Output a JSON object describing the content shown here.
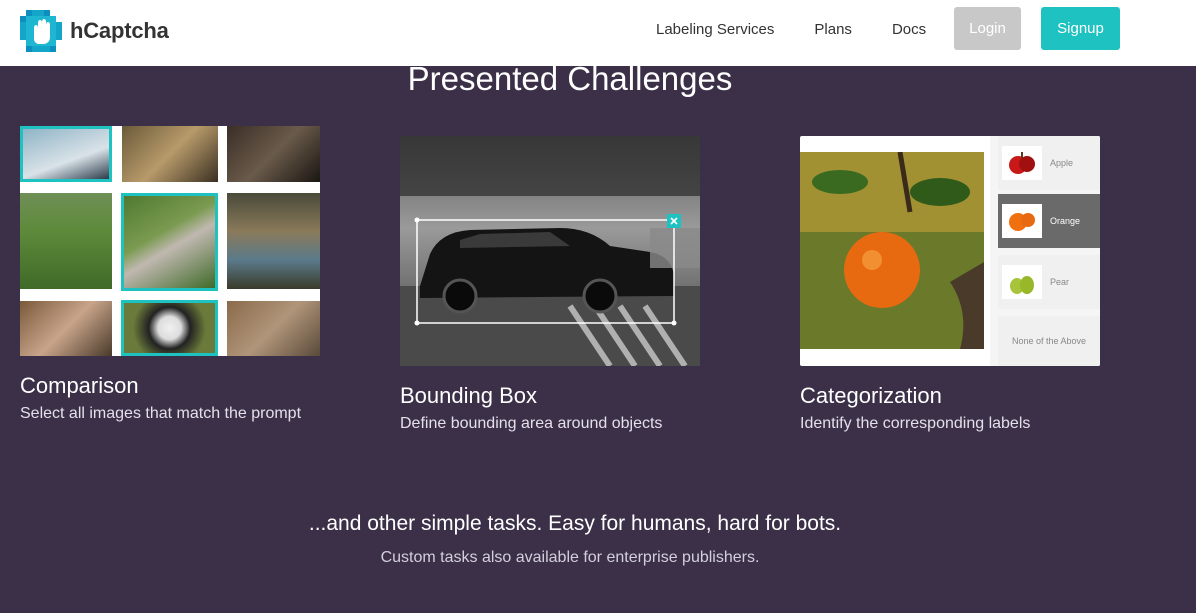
{
  "nav": {
    "brand": "hCaptcha",
    "links": [
      "Labeling Services",
      "Plans",
      "Docs"
    ],
    "login": "Login",
    "signup": "Signup"
  },
  "section": {
    "title": "Presented Challenges"
  },
  "cards": [
    {
      "title": "Comparison",
      "desc": "Select all images that match the prompt"
    },
    {
      "title": "Bounding Box",
      "desc": "Define bounding area around objects"
    },
    {
      "title": "Categorization",
      "desc": "Identify the corresponding labels"
    }
  ],
  "categorization": {
    "options": [
      "Apple",
      "Orange",
      "Pear",
      "None of the Above"
    ],
    "selected": "Orange"
  },
  "tagline": "...and other simple tasks. Easy for humans, hard for bots.",
  "subline": "Custom tasks  also available for enterprise publishers.",
  "colors": {
    "background": "#3b3048",
    "accent": "#1ec2c0",
    "login_button": "#c8c8c8"
  },
  "icons": [
    "hcaptcha-logo-icon",
    "close-icon"
  ]
}
